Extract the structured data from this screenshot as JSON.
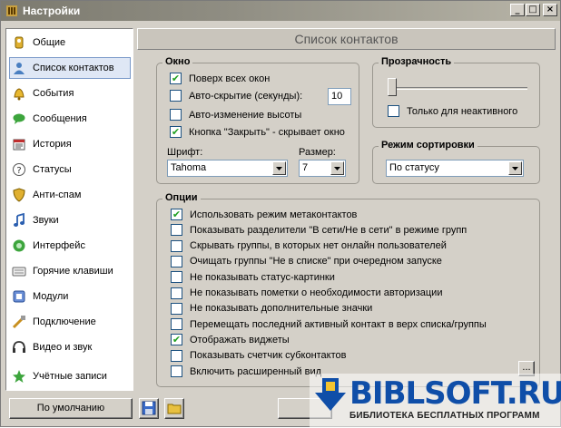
{
  "window": {
    "title": "Настройки",
    "controls": {
      "minimize": "_",
      "maximize": "□",
      "close": "×"
    }
  },
  "sidebar": {
    "items": [
      {
        "label": "Общие",
        "icon": "general-icon",
        "selected": false
      },
      {
        "label": "Список контактов",
        "icon": "contacts-icon",
        "selected": true
      },
      {
        "label": "События",
        "icon": "bell-icon",
        "selected": false
      },
      {
        "label": "Сообщения",
        "icon": "messages-icon",
        "selected": false
      },
      {
        "label": "История",
        "icon": "history-icon",
        "selected": false
      },
      {
        "label": "Статусы",
        "icon": "status-icon",
        "selected": false
      },
      {
        "label": "Анти-спам",
        "icon": "shield-icon",
        "selected": false
      },
      {
        "label": "Звуки",
        "icon": "music-note-icon",
        "selected": false
      },
      {
        "label": "Интерфейс",
        "icon": "interface-icon",
        "selected": false
      },
      {
        "label": "Горячие клавиши",
        "icon": "keyboard-icon",
        "selected": false
      },
      {
        "label": "Модули",
        "icon": "modules-icon",
        "selected": false
      },
      {
        "label": "Подключение",
        "icon": "connection-icon",
        "selected": false
      },
      {
        "label": "Видео и звук",
        "icon": "headset-icon",
        "selected": false
      },
      {
        "label": "Учётные записи",
        "icon": "accounts-icon",
        "selected": false
      }
    ]
  },
  "header": {
    "title": "Список контактов"
  },
  "window_group": {
    "title": "Окно",
    "always_on_top": {
      "label": "Поверх всех окон",
      "checked": true
    },
    "auto_hide": {
      "label": "Авто-скрытие (секунды):",
      "checked": false,
      "value": "10"
    },
    "auto_height": {
      "label": "Авто-изменение высоты",
      "checked": false
    },
    "close_hides": {
      "label": "Кнопка \"Закрыть\" - скрывает окно",
      "checked": true
    },
    "font_label": "Шрифт:",
    "font_value": "Tahoma",
    "size_label": "Размер:",
    "size_value": "7"
  },
  "transparency": {
    "title": "Прозрачность",
    "level": 0,
    "inactive_only": {
      "label": "Только для неактивного",
      "checked": false
    }
  },
  "sorting": {
    "title": "Режим сортировки",
    "value": "По статусу"
  },
  "options": {
    "title": "Опции",
    "items": [
      {
        "label": "Использовать режим метаконтактов",
        "checked": true
      },
      {
        "label": "Показывать разделители \"В сети/Не в сети\" в режиме групп",
        "checked": false
      },
      {
        "label": "Скрывать группы, в которых нет онлайн пользователей",
        "checked": false
      },
      {
        "label": "Очищать группы \"Не в списке\" при очередном запуске",
        "checked": false
      },
      {
        "label": "Не показывать статус-картинки",
        "checked": false
      },
      {
        "label": "Не показывать пометки о необходимости авторизации",
        "checked": false
      },
      {
        "label": "Не показывать дополнительные значки",
        "checked": false
      },
      {
        "label": "Перемещать последний активный контакт в верх списка/группы",
        "checked": false
      },
      {
        "label": "Отображать виджеты",
        "checked": true
      },
      {
        "label": "Показывать счетчик субконтактов",
        "checked": false
      },
      {
        "label": "Включить расширенный вид",
        "checked": false
      }
    ],
    "more_button": "..."
  },
  "footer": {
    "default_button": "По умолчанию",
    "save_icon": "save-icon",
    "open_icon": "folder-icon"
  },
  "watermark": {
    "brand": "BIBLSOFT.RU",
    "tagline": "БИБЛИОТЕКА БЕСПЛАТНЫХ ПРОГРАММ"
  },
  "colors": {
    "window_bg": "#d4d0c8",
    "selection": "#dfe7f5",
    "check": "#21a121",
    "watermark_blue": "#0f4ea8"
  }
}
